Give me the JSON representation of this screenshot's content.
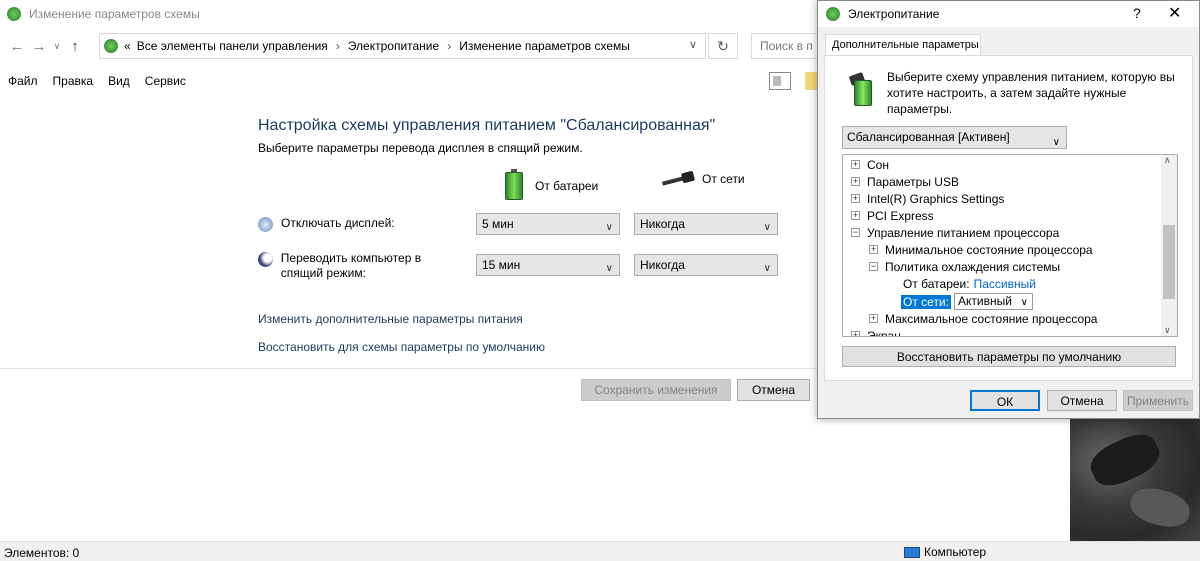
{
  "window": {
    "title": "Изменение параметров схемы"
  },
  "nav": {
    "breadcrumb": [
      "Все элементы панели управления",
      "Электропитание",
      "Изменение параметров схемы"
    ],
    "breadcrumb_prefix": "«",
    "search_placeholder": "Поиск в п"
  },
  "menu": [
    "Файл",
    "Правка",
    "Вид",
    "Сервис"
  ],
  "main": {
    "heading": "Настройка схемы управления питанием \"Сбалансированная\"",
    "subheading": "Выберите параметры перевода дисплея в спящий режим.",
    "col_battery": "От батареи",
    "col_ac": "От сети",
    "rows": [
      {
        "label": "Отключать дисплей:",
        "battery": "5 мин",
        "ac": "Никогда"
      },
      {
        "label": "Переводить компьютер в спящий режим:",
        "battery": "15 мин",
        "ac": "Никогда"
      }
    ],
    "link_advanced": "Изменить дополнительные параметры питания",
    "link_restore": "Восстановить для схемы параметры по умолчанию",
    "save": "Сохранить изменения",
    "cancel": "Отмена"
  },
  "status": {
    "items": "Элементов: 0",
    "location": "Компьютер"
  },
  "dialog": {
    "title": "Электропитание",
    "help": "?",
    "close": "✕",
    "tab": "Дополнительные параметры",
    "description": "Выберите схему управления питанием, которую вы хотите настроить, а затем задайте нужные параметры.",
    "scheme": "Сбалансированная [Активен]",
    "tree": [
      {
        "text": "Сон",
        "pm": "+"
      },
      {
        "text": "Параметры USB",
        "pm": "+"
      },
      {
        "text": "Intel(R) Graphics Settings",
        "pm": "+"
      },
      {
        "text": "PCI Express",
        "pm": "+"
      },
      {
        "text": "Управление питанием процессора",
        "pm": "−"
      },
      {
        "text": "Минимальное состояние процессора",
        "pm": "+"
      },
      {
        "text": "Политика охлаждения системы",
        "pm": "−"
      },
      {
        "text": "Максимальное состояние процессора",
        "pm": "+"
      },
      {
        "text": "Экран",
        "pm": "+"
      }
    ],
    "battery_label": "От батареи:",
    "battery_value": "Пассивный",
    "ac_label": "От сети:",
    "ac_value": "Активный",
    "restore": "Восстановить параметры по умолчанию",
    "ok": "ОК",
    "cancel": "Отмена",
    "apply": "Применить"
  }
}
